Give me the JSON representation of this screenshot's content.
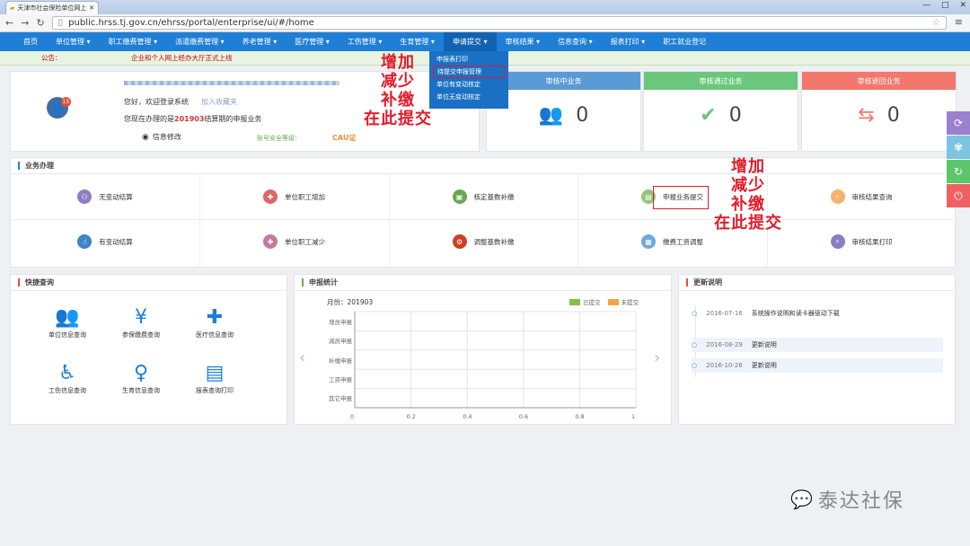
{
  "browser": {
    "tab_title": "天津市社会保险单位网上",
    "url": "public.hrss.tj.gov.cn/ehrss/portal/enterprise/ui/#/home",
    "window_controls": [
      "—",
      "□",
      "✕"
    ]
  },
  "nav": {
    "items": [
      "首页",
      "单位管理 ▾",
      "职工缴费管理 ▾",
      "派遣缴费管理 ▾",
      "养老管理 ▾",
      "医疗管理 ▾",
      "工伤管理 ▾",
      "生育管理 ▾",
      "申请提交 ▾",
      "审核结果 ▾",
      "信息查询 ▾",
      "报表打印 ▾",
      "职工就业登记"
    ],
    "active_index": 8,
    "dropdown": [
      "申报表打印",
      "待提交申报管理",
      "单位有变动核定",
      "单位无变动核定"
    ],
    "dropdown_selected": 1
  },
  "notice": {
    "label": "公告：",
    "text": "企业和个人网上经办大厅正式上线"
  },
  "user": {
    "badge": "15",
    "welcome": "您好，欢迎登录系统",
    "favorite": "加入收藏夹",
    "period_prefix": "您现在办理的是",
    "period": "201903",
    "period_suffix": "结算期的申报业务",
    "info_edit": "信息修改",
    "security_label": "账号安全等级：",
    "cert": "CAU证"
  },
  "stats": [
    {
      "title": "审核中业务",
      "value": "0",
      "color": "#5b9bd5",
      "icon": "users-icon"
    },
    {
      "title": "审核通过业务",
      "value": "0",
      "color": "#6bc77b",
      "icon": "approved-icon"
    },
    {
      "title": "审核退回业务",
      "value": "0",
      "color": "#f2776d",
      "icon": "return-icon"
    }
  ],
  "annotation": {
    "lines": [
      "增加",
      "减少",
      "补缴",
      "在此提交"
    ]
  },
  "business": {
    "title": "业务办理",
    "items": [
      {
        "label": "无变动结算",
        "color": "#8e7cc3"
      },
      {
        "label": "单位职工增加",
        "color": "#e06666"
      },
      {
        "label": "核定基数补缴",
        "color": "#6aa84f"
      },
      {
        "label": "申报业务提交",
        "color": "#93c47d"
      },
      {
        "label": "审核结果查询",
        "color": "#f6b26b"
      },
      {
        "label": "有变动结算",
        "color": "#3d85c6"
      },
      {
        "label": "单位职工减少",
        "color": "#c27ba0"
      },
      {
        "label": "调整基数补缴",
        "color": "#cc4125"
      },
      {
        "label": "缴费工资调整",
        "color": "#6fa8dc"
      },
      {
        "label": "审核结果打印",
        "color": "#8e7cc3"
      }
    ]
  },
  "quick": {
    "title": "快捷查询",
    "items": [
      {
        "label": "单位信息查询",
        "icon": "group-icon",
        "glyph": "👥"
      },
      {
        "label": "参保缴费查询",
        "icon": "money-search-icon",
        "glyph": "¥"
      },
      {
        "label": "医疗信息查询",
        "icon": "medical-kit-icon",
        "glyph": "✚"
      },
      {
        "label": "工伤信息查询",
        "icon": "injury-icon",
        "glyph": "♿"
      },
      {
        "label": "生育信息查询",
        "icon": "maternity-icon",
        "glyph": "♀"
      },
      {
        "label": "报表查询打印",
        "icon": "report-search-icon",
        "glyph": "▤"
      }
    ]
  },
  "chart_data": {
    "type": "bar",
    "title": "申报统计",
    "month_label": "月份：",
    "month": "201903",
    "orientation": "horizontal",
    "categories": [
      "增员申报",
      "减员申报",
      "补缴申报",
      "工资申报",
      "其它申报"
    ],
    "series": [
      {
        "name": "已提交",
        "color": "#7dc242",
        "values": [
          0,
          0,
          0,
          0,
          0
        ]
      },
      {
        "name": "未提交",
        "color": "#f7a345",
        "values": [
          0,
          0,
          0,
          0,
          0
        ]
      }
    ],
    "xlim": [
      0,
      1
    ],
    "xticks": [
      "0",
      "0.2",
      "0.4",
      "0.6",
      "0.8",
      "1"
    ],
    "legend": "top-right"
  },
  "updates": {
    "title": "更新说明",
    "items": [
      {
        "date": "2016-07-16",
        "text": "系统操作说明和读卡器驱动下载"
      },
      {
        "date": "2016-08-29",
        "text": "更新说明"
      },
      {
        "date": "2016-10-26",
        "text": "更新说明"
      }
    ]
  },
  "watermark": "泰达社保",
  "side_buttons": [
    {
      "icon": "sync-icon",
      "color": "#9b7fd1"
    },
    {
      "icon": "tree-icon",
      "color": "#7cc4e0"
    },
    {
      "icon": "refresh-icon",
      "color": "#5cc76a"
    },
    {
      "icon": "power-icon",
      "color": "#f06060"
    }
  ]
}
